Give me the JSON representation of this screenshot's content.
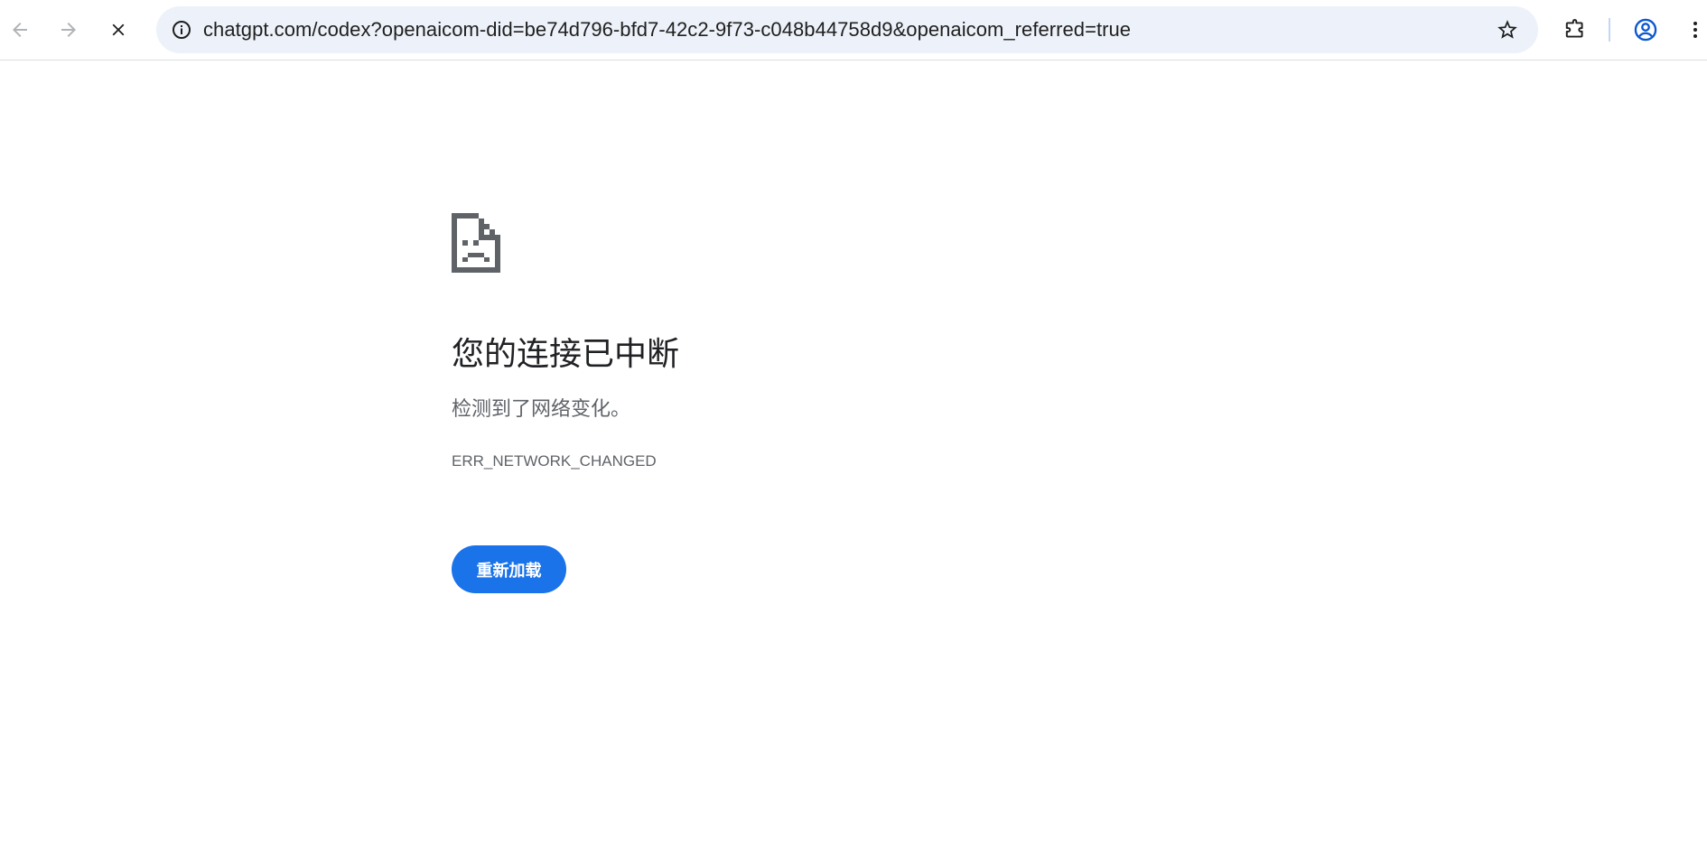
{
  "browser": {
    "url": "chatgpt.com/codex?openaicom-did=be74d796-bfd7-42c2-9f73-c048b44758d9&openaicom_referred=true",
    "icons": {
      "back": "arrow-left-icon",
      "forward": "arrow-right-icon",
      "stop": "close-icon",
      "site_info": "info-circle-icon",
      "bookmark": "star-outline-icon",
      "extensions": "puzzle-icon",
      "profile": "account-circle-icon",
      "menu": "vertical-dots-icon"
    },
    "colors": {
      "omnibox_bg": "#edf2fa",
      "profile_accent": "#0b57d0"
    }
  },
  "error_page": {
    "icon": "sad-document-icon",
    "title": "您的连接已中断",
    "description": "检测到了网络变化。",
    "error_code": "ERR_NETWORK_CHANGED",
    "reload_label": "重新加载",
    "colors": {
      "button": "#1a73e8",
      "title": "#202124",
      "secondary_text": "#5f6368"
    }
  }
}
